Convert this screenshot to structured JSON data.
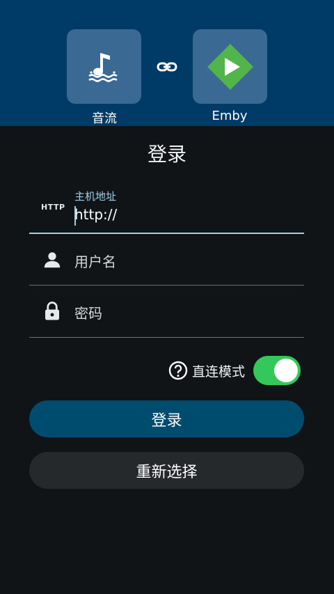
{
  "header": {
    "source_app": {
      "name": "音流",
      "icon": "music-note-waves-icon"
    },
    "link_icon": "link-icon",
    "target_app": {
      "name": "Emby",
      "icon": "emby-logo-icon",
      "brand_color": "#52b54b"
    },
    "background_color": "#003a66"
  },
  "login_title": "登录",
  "form": {
    "host": {
      "icon": "http-icon",
      "icon_text": "HTTP",
      "label": "主机地址",
      "value": "http://",
      "focused": true
    },
    "username": {
      "icon": "person-icon",
      "placeholder": "用户名"
    },
    "password": {
      "icon": "lock-icon",
      "placeholder": "密码"
    }
  },
  "direct_mode": {
    "help_icon": "help-circle-icon",
    "label": "直连模式",
    "enabled": true,
    "toggle_color": "#34c759"
  },
  "buttons": {
    "login": "登录",
    "reselect": "重新选择"
  },
  "colors": {
    "accent": "#9fd0ee",
    "login_button": "#004c6e",
    "secondary_button": "#25292c",
    "background": "#101417"
  }
}
